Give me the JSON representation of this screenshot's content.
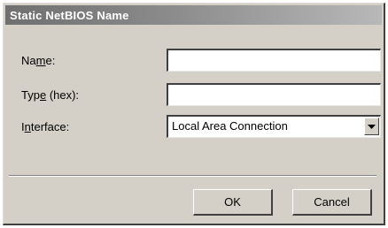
{
  "window": {
    "title": "Static NetBIOS Name"
  },
  "form": {
    "name": {
      "label_pre": "Na",
      "label_key": "m",
      "label_post": "e:",
      "value": ""
    },
    "type": {
      "label_pre": "Typ",
      "label_key": "e",
      "label_post": " (hex):",
      "value": ""
    },
    "interface": {
      "label_pre": "I",
      "label_key": "n",
      "label_post": "terface:",
      "selected": "Local Area Connection"
    }
  },
  "buttons": {
    "ok_label": "OK",
    "cancel_label": "Cancel"
  },
  "icons": {
    "dropdown": "chevron-down-icon"
  },
  "colors": {
    "dialog_bg": "#d4d0c8",
    "title_text": "#ffffff",
    "field_bg": "#ffffff"
  }
}
